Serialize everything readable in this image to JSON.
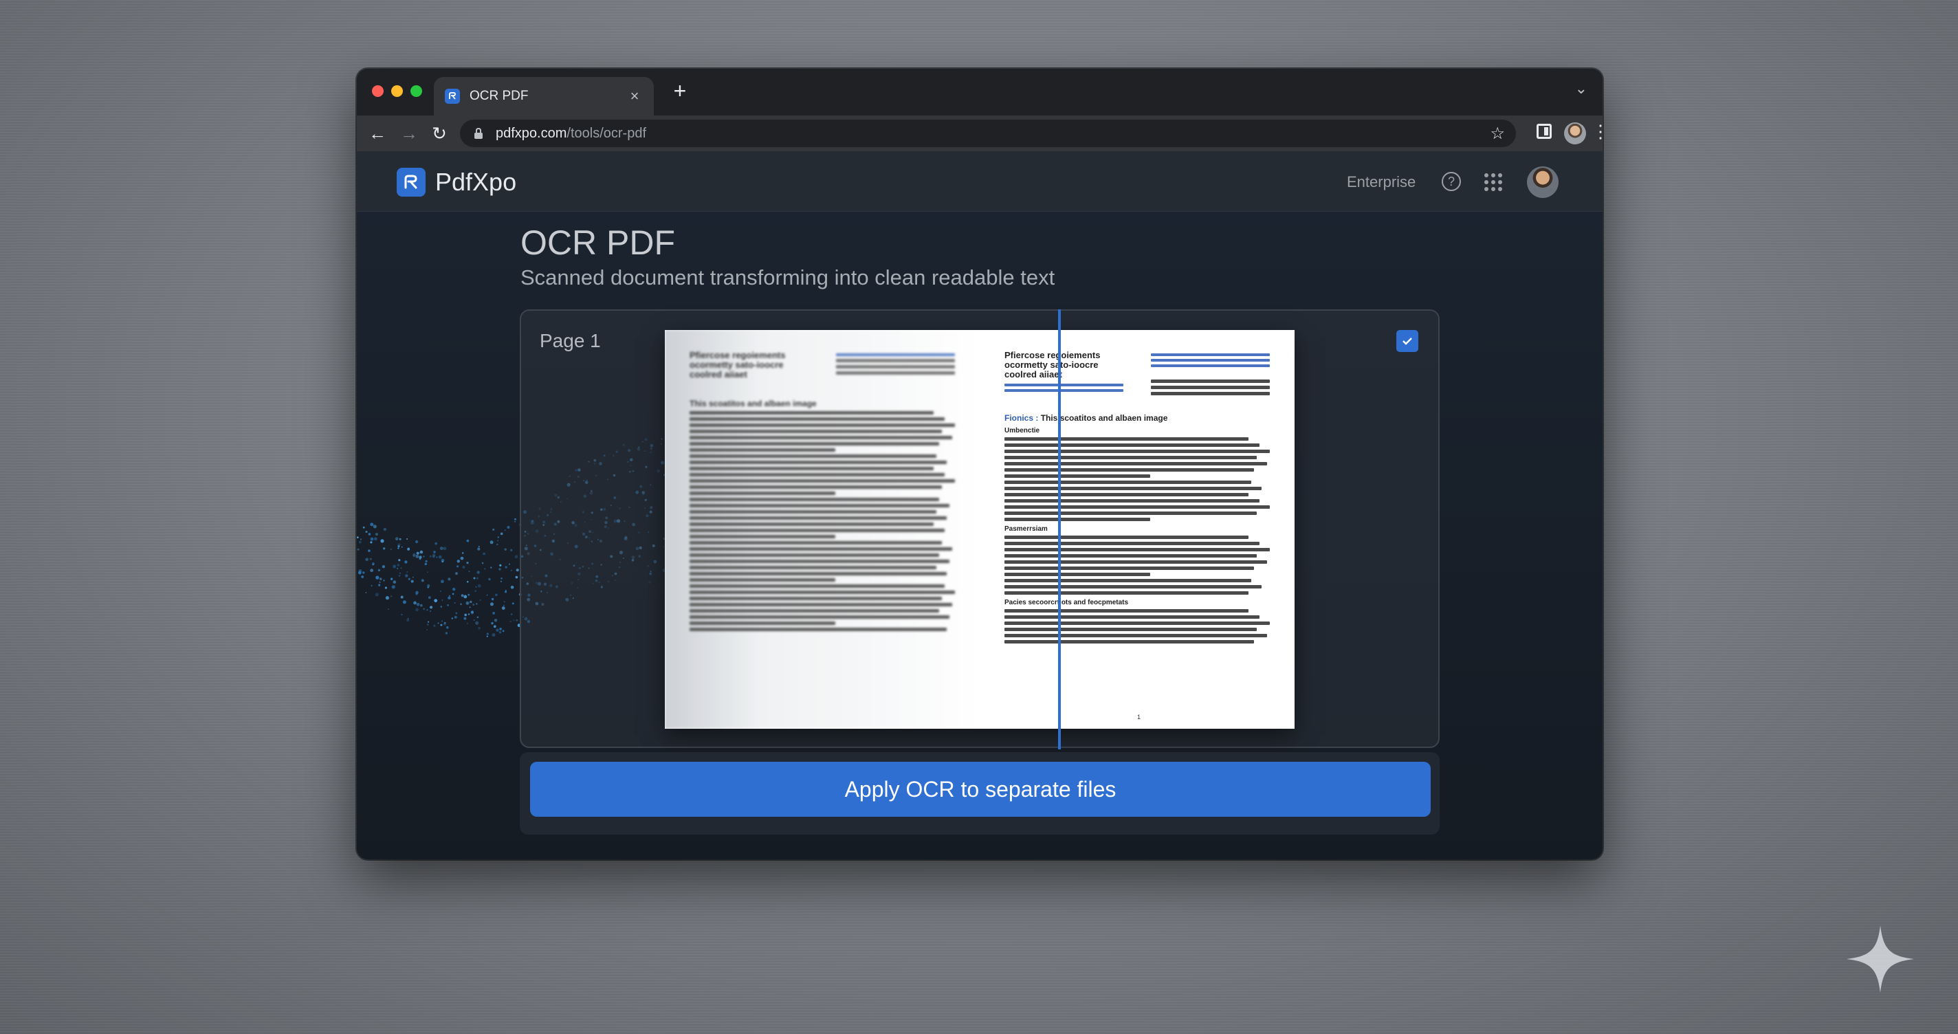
{
  "browser": {
    "tab_title": "OCR PDF",
    "tab_close": "×",
    "new_tab": "+",
    "url_host": "pdfxpo.com",
    "url_path": "/tools/ocr-pdf"
  },
  "header": {
    "brand": "PdfXpo",
    "enterprise": "Enterprise"
  },
  "main": {
    "title": "OCR PDF",
    "subtitle": "Scanned document transforming into clean readable text",
    "page_label": "Page 1",
    "page_checked": true,
    "apply_button": "Apply OCR to separate files"
  },
  "document": {
    "heading": "Pfiercose regoiements ocormetty sato-ioocre coolred aiiaet",
    "section": "This scoatitos and albaen image",
    "section_prefix": "Fionics :",
    "sub_heads": [
      "Umbenctie",
      "Pasmerrsiam",
      "Pacies secoorcrtiots and feocpmetats"
    ],
    "page_number": "1"
  },
  "colors": {
    "accent": "#2f6fd1",
    "background": "#151b23"
  }
}
